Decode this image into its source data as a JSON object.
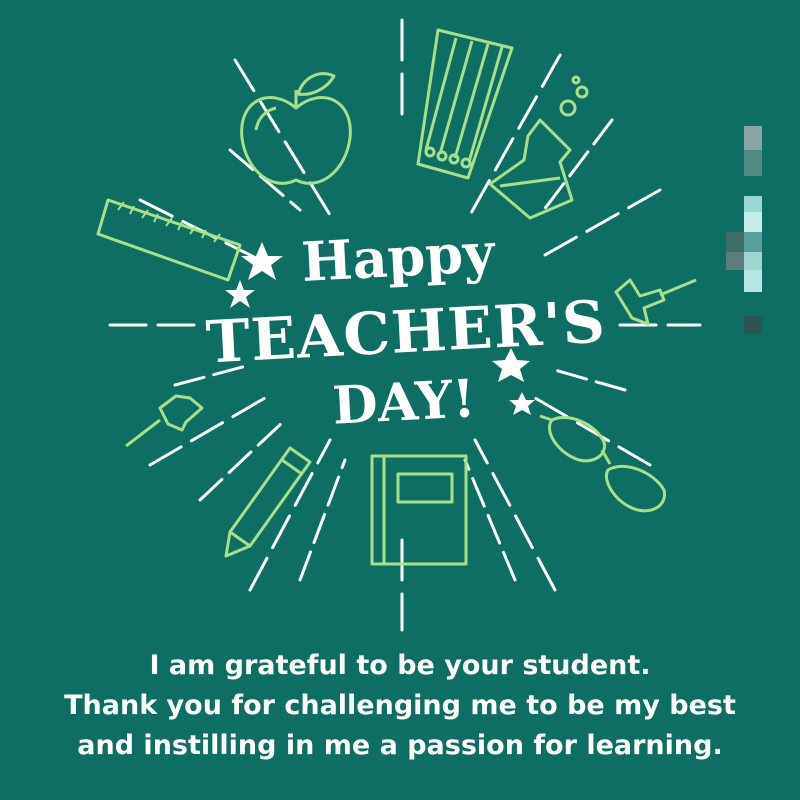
{
  "headline": {
    "word1": "Happy",
    "word2": "TEACHER'S",
    "word3": "DAY!"
  },
  "message": {
    "line1": "I am grateful to be your student.",
    "line2": "Thank you for challenging me to be my best",
    "line3": "and instilling in me a passion for learning."
  },
  "colors": {
    "background": "#0e6e64",
    "accent_green": "#a6e08a",
    "text": "#ffffff"
  }
}
